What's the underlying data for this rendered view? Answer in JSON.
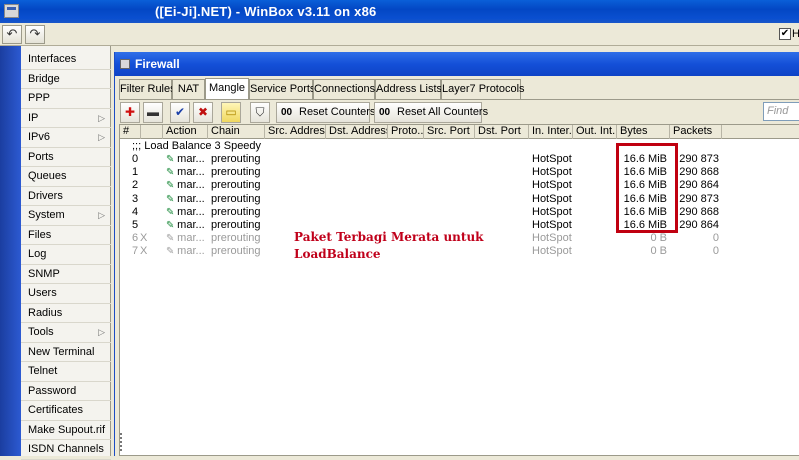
{
  "window": {
    "title": "([Ei-Ji].NET) - WinBox v3.11 on x86"
  },
  "toolbar": {
    "undo_icon": "undo-icon",
    "redo_icon": "redo-icon",
    "hold_label": "H"
  },
  "sidebar": {
    "items": [
      {
        "label": "Interfaces",
        "arrow": false
      },
      {
        "label": "Bridge",
        "arrow": false
      },
      {
        "label": "PPP",
        "arrow": false
      },
      {
        "label": "IP",
        "arrow": true
      },
      {
        "label": "IPv6",
        "arrow": true
      },
      {
        "label": "Ports",
        "arrow": false
      },
      {
        "label": "Queues",
        "arrow": false
      },
      {
        "label": "Drivers",
        "arrow": false
      },
      {
        "label": "System",
        "arrow": true
      },
      {
        "label": "Files",
        "arrow": false
      },
      {
        "label": "Log",
        "arrow": false
      },
      {
        "label": "SNMP",
        "arrow": false
      },
      {
        "label": "Users",
        "arrow": false
      },
      {
        "label": "Radius",
        "arrow": false
      },
      {
        "label": "Tools",
        "arrow": true
      },
      {
        "label": "New Terminal",
        "arrow": false
      },
      {
        "label": "Telnet",
        "arrow": false
      },
      {
        "label": "Password",
        "arrow": false
      },
      {
        "label": "Certificates",
        "arrow": false
      },
      {
        "label": "Make Supout.rif",
        "arrow": false
      },
      {
        "label": "ISDN Channels",
        "arrow": false
      }
    ],
    "arrow_glyph": "▷"
  },
  "firewall": {
    "title": "Firewall",
    "tabs": [
      "Filter Rules",
      "NAT",
      "Mangle",
      "Service Ports",
      "Connections",
      "Address Lists",
      "Layer7 Protocols"
    ],
    "active_tab": "Mangle",
    "buttons": {
      "add": "✚",
      "remove": "▬",
      "enable": "✔",
      "disable": "✖",
      "comment": "▭",
      "filter": "⛉",
      "reset_counters": "Reset Counters",
      "reset_all_counters": "Reset All Counters",
      "oo": "00"
    },
    "find_placeholder": "Find",
    "columns": [
      "#",
      "",
      "Action",
      "Chain",
      "Src. Address",
      "Dst. Address",
      "Proto...",
      "Src. Port",
      "Dst. Port",
      "In. Inter...",
      "Out. Int...",
      "Bytes",
      "Packets"
    ],
    "comment": ";;; Load Balance 3 Speedy",
    "rows": [
      {
        "num": "0",
        "flag": "",
        "action": "mar...",
        "chain": "prerouting",
        "in": "HotSpot",
        "bytes": "16.6 MiB",
        "packets": "290 873",
        "disabled": false
      },
      {
        "num": "1",
        "flag": "",
        "action": "mar...",
        "chain": "prerouting",
        "in": "HotSpot",
        "bytes": "16.6 MiB",
        "packets": "290 868",
        "disabled": false
      },
      {
        "num": "2",
        "flag": "",
        "action": "mar...",
        "chain": "prerouting",
        "in": "HotSpot",
        "bytes": "16.6 MiB",
        "packets": "290 864",
        "disabled": false
      },
      {
        "num": "3",
        "flag": "",
        "action": "mar...",
        "chain": "prerouting",
        "in": "HotSpot",
        "bytes": "16.6 MiB",
        "packets": "290 873",
        "disabled": false
      },
      {
        "num": "4",
        "flag": "",
        "action": "mar...",
        "chain": "prerouting",
        "in": "HotSpot",
        "bytes": "16.6 MiB",
        "packets": "290 868",
        "disabled": false
      },
      {
        "num": "5",
        "flag": "",
        "action": "mar...",
        "chain": "prerouting",
        "in": "HotSpot",
        "bytes": "16.6 MiB",
        "packets": "290 864",
        "disabled": false
      },
      {
        "num": "6",
        "flag": "X",
        "action": "mar...",
        "chain": "prerouting",
        "in": "HotSpot",
        "bytes": "0 B",
        "packets": "0",
        "disabled": true
      },
      {
        "num": "7",
        "flag": "X",
        "action": "mar...",
        "chain": "prerouting",
        "in": "HotSpot",
        "bytes": "0 B",
        "packets": "0",
        "disabled": true
      }
    ]
  },
  "annotation": {
    "line1": "Paket Terbagi Merata untuk",
    "line2": "LoadBalance",
    "color": "#c0001a"
  },
  "colors": {
    "titlebar": "#0a4fd0",
    "sidebar_band": "#1b3ea0",
    "highlight_box": "#c00010"
  }
}
